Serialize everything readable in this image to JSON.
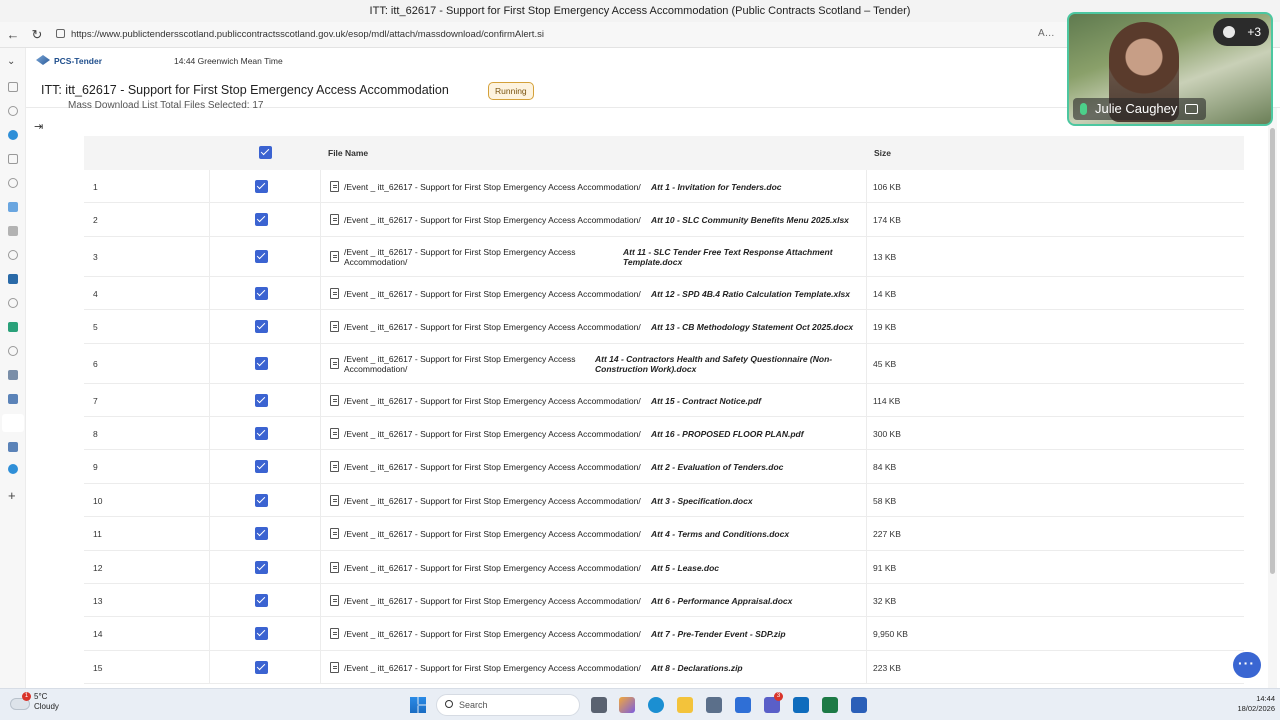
{
  "window": {
    "title": "ITT: itt_62617 - Support for First Stop Emergency Access Accommodation (Public Contracts Scotland – Tender)"
  },
  "browser": {
    "url": "https://www.publictendersscotland.publiccontractsscotland.gov.uk/esop/mdl/attach/massdownload/confirmAlert.si",
    "back_icon": "arrow-left",
    "refresh_icon": "refresh"
  },
  "app": {
    "brand": "PCS-Tender",
    "clock": "14:44 Greenwich Mean Time",
    "page_title": "ITT: itt_62617 - Support for First Stop Emergency Access Accommodation",
    "status": "Running",
    "subline": "Mass Download List Total Files Selected: 17"
  },
  "table": {
    "headers": {
      "file_name": "File Name",
      "size": "Size"
    },
    "rows": [
      {
        "num": "1",
        "path": "/Event _ itt_62617 - Support for First Stop Emergency Access Accommodation/",
        "att": "Att 1 - Invitation for Tenders.doc",
        "size": "106 KB"
      },
      {
        "num": "2",
        "path": "/Event _ itt_62617 - Support for First Stop Emergency Access Accommodation/",
        "att": "Att 10 - SLC Community Benefits Menu 2025.xlsx",
        "size": "174 KB"
      },
      {
        "num": "3",
        "path": "/Event _ itt_62617 - Support for First Stop Emergency Access Accommodation/",
        "att": "Att 11 - SLC Tender Free Text Response Attachment Template.docx",
        "size": "13 KB"
      },
      {
        "num": "4",
        "path": "/Event _ itt_62617 - Support for First Stop Emergency Access Accommodation/",
        "att": "Att 12 - SPD 4B.4 Ratio Calculation Template.xlsx",
        "size": "14 KB"
      },
      {
        "num": "5",
        "path": "/Event _ itt_62617 - Support for First Stop Emergency Access Accommodation/",
        "att": "Att 13 - CB Methodology Statement Oct 2025.docx",
        "size": "19 KB"
      },
      {
        "num": "6",
        "path": "/Event _ itt_62617 - Support for First Stop Emergency Access Accommodation/",
        "att": "Att 14 - Contractors Health and Safety Questionnaire (Non-Construction Work).docx",
        "size": "45 KB"
      },
      {
        "num": "7",
        "path": "/Event _ itt_62617 - Support for First Stop Emergency Access Accommodation/",
        "att": "Att 15 - Contract Notice.pdf",
        "size": "114 KB"
      },
      {
        "num": "8",
        "path": "/Event _ itt_62617 - Support for First Stop Emergency Access Accommodation/",
        "att": "Att 16 - PROPOSED FLOOR PLAN.pdf",
        "size": "300 KB"
      },
      {
        "num": "9",
        "path": "/Event _ itt_62617 - Support for First Stop Emergency Access Accommodation/",
        "att": "Att 2 - Evaluation of Tenders.doc",
        "size": "84 KB"
      },
      {
        "num": "10",
        "path": "/Event _ itt_62617 - Support for First Stop Emergency Access Accommodation/",
        "att": "Att 3 - Specification.docx",
        "size": "58 KB"
      },
      {
        "num": "11",
        "path": "/Event _ itt_62617 - Support for First Stop Emergency Access Accommodation/",
        "att": "Att 4 - Terms and Conditions.docx",
        "size": "227 KB"
      },
      {
        "num": "12",
        "path": "/Event _ itt_62617 - Support for First Stop Emergency Access Accommodation/",
        "att": "Att 5 - Lease.doc",
        "size": "91 KB"
      },
      {
        "num": "13",
        "path": "/Event _ itt_62617 - Support for First Stop Emergency Access Accommodation/",
        "att": "Att 6 - Performance Appraisal.docx",
        "size": "32 KB"
      },
      {
        "num": "14",
        "path": "/Event _ itt_62617 - Support for First Stop Emergency Access Accommodation/",
        "att": "Att 7 - Pre-Tender Event - SDP.zip",
        "size": "9,950 KB"
      },
      {
        "num": "15",
        "path": "/Event _ itt_62617 - Support for First Stop Emergency Access Accommodation/",
        "att": "Att 8 - Declarations.zip",
        "size": "223 KB"
      }
    ]
  },
  "video": {
    "participant": "Julie Caughey",
    "others": "+3"
  },
  "taskbar": {
    "temperature": "5°C",
    "weather": "Cloudy",
    "weather_alert": "1",
    "search_label": "Search",
    "teams_badge": "3",
    "time": "14:44",
    "date": "18/02/2026"
  },
  "colors": {
    "accent": "#3b63d1",
    "status_badge_border": "#d4a13a",
    "video_border": "#4cc7a0"
  }
}
